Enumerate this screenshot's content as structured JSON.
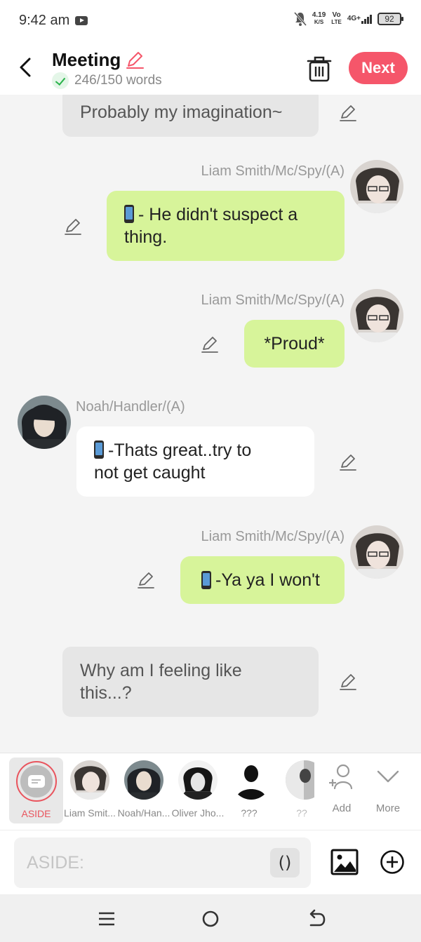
{
  "status_bar": {
    "time": "9:42 am",
    "speed_value": "4.19",
    "speed_unit": "K/S",
    "volte_top": "Vo",
    "volte_bottom": "LTE",
    "network": "4G+",
    "battery": "92"
  },
  "header": {
    "title": "Meeting",
    "word_count": "246/150 words",
    "next_label": "Next",
    "accent_color": "#f5566a"
  },
  "messages": [
    {
      "type": "aside",
      "text": "Probably my imagination~"
    },
    {
      "type": "right",
      "name": "Liam Smith/Mc/Spy/(A)",
      "phone": true,
      "text_line1": "- He didn't suspect a",
      "text_line2": "thing."
    },
    {
      "type": "right",
      "name": "Liam Smith/Mc/Spy/(A)",
      "phone": false,
      "text_line1": "*Proud*"
    },
    {
      "type": "left",
      "name": "Noah/Handler/(A)",
      "phone": true,
      "text_line1": "-Thats great..try to",
      "text_line2": "not get caught"
    },
    {
      "type": "right",
      "name": "Liam Smith/Mc/Spy/(A)",
      "phone": true,
      "text_line1": "-Ya ya I won't"
    },
    {
      "type": "aside",
      "text_line1": "Why am I feeling like",
      "text_line2": "this...?"
    }
  ],
  "characters": [
    {
      "label": "ASIDE",
      "selected": true
    },
    {
      "label": "Liam Smit..."
    },
    {
      "label": "Noah/Han..."
    },
    {
      "label": "Oliver Jho..."
    },
    {
      "label": "???"
    },
    {
      "label": "??"
    }
  ],
  "tools": {
    "add_label": "Add",
    "more_label": "More"
  },
  "input": {
    "placeholder": "ASIDE:",
    "paren_label": "()"
  },
  "colors": {
    "right_bubble": "#d7f49a",
    "aside_bubble": "#e6e6e6",
    "aside_selected": "#e9545d"
  }
}
